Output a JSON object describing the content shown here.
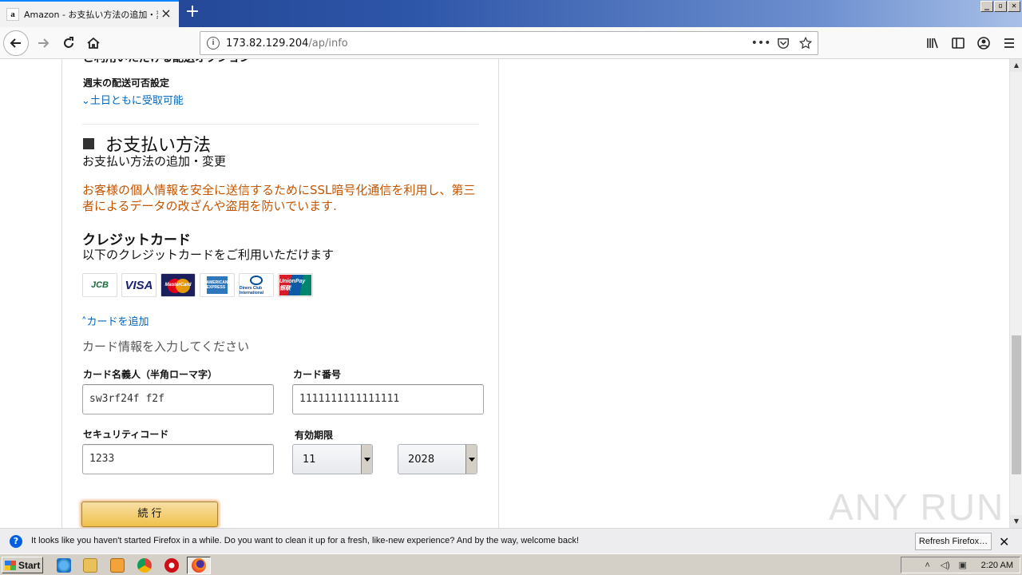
{
  "browser": {
    "tab": {
      "favicon": "a",
      "title": "Amazon - お支払い方法の追加・変更"
    },
    "window_buttons": [
      "_",
      "▫",
      "✕"
    ],
    "url": {
      "host": "173.82.129.204",
      "path": "/ap/info"
    },
    "icons": [
      "back-icon",
      "forward-icon",
      "reload-icon",
      "home-icon",
      "info-icon",
      "more-icon",
      "pocket-icon",
      "bookmark-star-icon",
      "library-icon",
      "sidebar-icon",
      "account-icon",
      "menu-icon"
    ]
  },
  "page": {
    "cutoff_heading": "ご利用いただける配送オプション",
    "weekend_label": "週末の配送可否設定",
    "weekend_link": "土日ともに受取可能",
    "payment_heading": "お支払い方法",
    "payment_sub": "お支払い方法の追加・変更",
    "ssl_note": "お客様の個人情報を安全に送信するためにSSL暗号化通信を利用し、第三者によるデータの改ざんや盗用を防いでいます.",
    "cc_title": "クレジットカード",
    "cc_sub": "以下のクレジットカードをご利用いただけます",
    "cards": {
      "jcb": "JCB",
      "visa": "VISA",
      "mastercard": "MasterCard",
      "amex": "AMERICAN EXPRESS",
      "diners": "Diners Club International",
      "unionpay": "UnionPay 银联"
    },
    "add_card_link": "カードを追加",
    "enter_info": "カード情報を入力してください",
    "form": {
      "name_label": "カード名義人（半角ローマ字）",
      "name_value": "sw3rf24f f2f",
      "number_label": "カード番号",
      "number_value": "1111111111111111",
      "cvc_label": "セキュリティコード",
      "cvc_value": "1233",
      "expiry_label": "有効期限",
      "expiry_month": "11",
      "expiry_year": "2028"
    },
    "continue_button": "続 行"
  },
  "watermark": "ANY RUN",
  "notification": {
    "text": "It looks like you haven't started Firefox in a while. Do you want to clean it up for a fresh, like-new experience? And by the way, welcome back!",
    "button": "Refresh Firefox…"
  },
  "taskbar": {
    "start": "Start",
    "clock": "2:20 AM"
  },
  "colors": {
    "link": "#0066c0",
    "warning_text": "#c45500",
    "button_yellow": "#f0c14b"
  }
}
